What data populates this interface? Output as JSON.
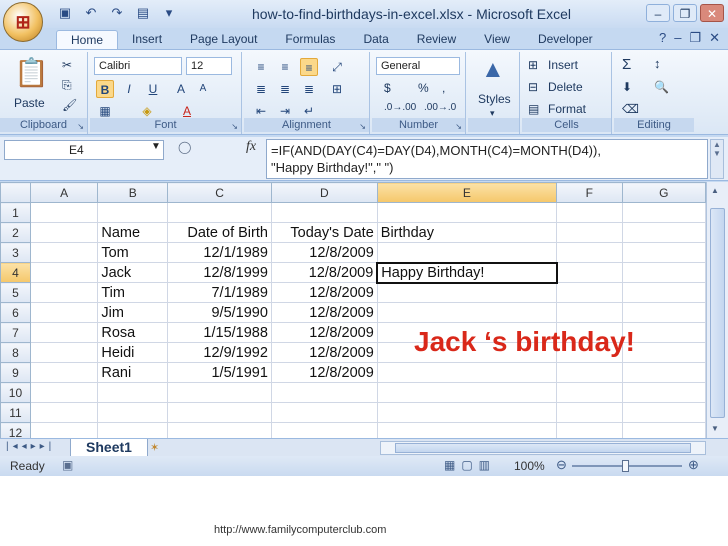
{
  "title": "how-to-find-birthdays-in-excel.xlsx - Microsoft Excel",
  "tabs": [
    "Home",
    "Insert",
    "Page Layout",
    "Formulas",
    "Data",
    "Review",
    "View",
    "Developer"
  ],
  "ribbon": {
    "clipboard": {
      "label": "Clipboard",
      "paste": "Paste"
    },
    "font": {
      "label": "Font",
      "name": "Calibri",
      "size": "12"
    },
    "alignment": {
      "label": "Alignment"
    },
    "number": {
      "label": "Number",
      "format": "General",
      "currency": "$",
      "percent": "%"
    },
    "styles": {
      "label": "Styles"
    },
    "cells": {
      "label": "Cells",
      "insert": "Insert",
      "delete": "Delete",
      "format": "Format"
    },
    "editing": {
      "label": "Editing"
    }
  },
  "formula_bar": {
    "name_box": "E4",
    "fx": "fx",
    "formula": "=IF(AND(DAY(C4)=DAY(D4),MONTH(C4)=MONTH(D4)),\n\"Happy Birthday!\",\" \")"
  },
  "columns": [
    "A",
    "B",
    "C",
    "D",
    "E",
    "F",
    "G"
  ],
  "rows": [
    {
      "n": "1",
      "b": "",
      "c": "",
      "d": "",
      "e": ""
    },
    {
      "n": "2",
      "b": "Name",
      "c": "Date of Birth",
      "d": "Today's Date",
      "e": "Birthday"
    },
    {
      "n": "3",
      "b": "Tom",
      "c": "12/1/1989",
      "d": "12/8/2009",
      "e": ""
    },
    {
      "n": "4",
      "b": "Jack",
      "c": "12/8/1999",
      "d": "12/8/2009",
      "e": "Happy Birthday!"
    },
    {
      "n": "5",
      "b": "Tim",
      "c": "7/1/1989",
      "d": "12/8/2009",
      "e": ""
    },
    {
      "n": "6",
      "b": "Jim",
      "c": "9/5/1990",
      "d": "12/8/2009",
      "e": ""
    },
    {
      "n": "7",
      "b": "Rosa",
      "c": "1/15/1988",
      "d": "12/8/2009",
      "e": ""
    },
    {
      "n": "8",
      "b": "Heidi",
      "c": "12/9/1992",
      "d": "12/8/2009",
      "e": ""
    },
    {
      "n": "9",
      "b": "Rani",
      "c": "1/5/1991",
      "d": "12/8/2009",
      "e": ""
    },
    {
      "n": "10",
      "b": "",
      "c": "",
      "d": "",
      "e": ""
    },
    {
      "n": "11",
      "b": "",
      "c": "",
      "d": "",
      "e": ""
    },
    {
      "n": "12",
      "b": "",
      "c": "",
      "d": "",
      "e": ""
    }
  ],
  "sheet_tab": "Sheet1",
  "status": {
    "ready": "Ready",
    "zoom": "100%"
  },
  "annotation": "Jack ‘s birthday!",
  "footer_url": "http://www.familycomputerclub.com",
  "colors": {
    "annotation": "#d9281a",
    "selected_header": "#f5c76a",
    "ribbon_bg": "#dbe7f5"
  }
}
